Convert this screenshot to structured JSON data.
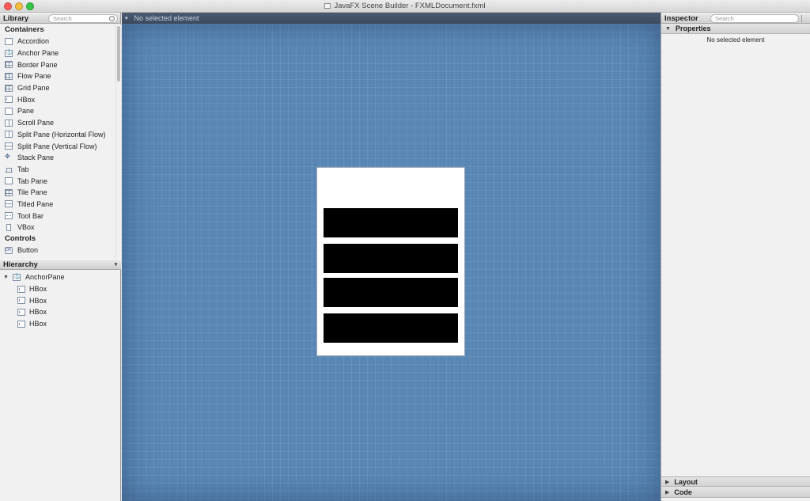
{
  "window": {
    "title": "JavaFX Scene Builder - FXMLDocument.fxml",
    "colors": {
      "close": "#fc5b57",
      "minimize": "#f7bd3e",
      "maximize": "#32c548"
    }
  },
  "library": {
    "title": "Library",
    "search_placeholder": "Search",
    "sections": [
      {
        "title": "Containers",
        "items": [
          {
            "label": "Accordion",
            "icon": "accordion-icon"
          },
          {
            "label": "Anchor Pane",
            "icon": "anchor-pane-icon"
          },
          {
            "label": "Border Pane",
            "icon": "border-pane-icon"
          },
          {
            "label": "Flow Pane",
            "icon": "flow-pane-icon"
          },
          {
            "label": "Grid Pane",
            "icon": "grid-pane-icon"
          },
          {
            "label": "HBox",
            "icon": "hbox-icon"
          },
          {
            "label": "Pane",
            "icon": "pane-icon"
          },
          {
            "label": "Scroll Pane",
            "icon": "scroll-pane-icon"
          },
          {
            "label": "Split Pane (Horizontal Flow)",
            "icon": "split-pane-horizontal-icon"
          },
          {
            "label": "Split Pane (Vertical Flow)",
            "icon": "split-pane-vertical-icon"
          },
          {
            "label": "Stack Pane",
            "icon": "stack-pane-icon"
          },
          {
            "label": "Tab",
            "icon": "tab-icon"
          },
          {
            "label": "Tab Pane",
            "icon": "tab-pane-icon"
          },
          {
            "label": "Tile Pane",
            "icon": "tile-pane-icon"
          },
          {
            "label": "Titled Pane",
            "icon": "titled-pane-icon"
          },
          {
            "label": "Tool Bar",
            "icon": "tool-bar-icon"
          },
          {
            "label": "VBox",
            "icon": "vbox-icon"
          }
        ]
      },
      {
        "title": "Controls",
        "items": [
          {
            "label": "Button",
            "icon": "button-icon"
          }
        ]
      }
    ]
  },
  "hierarchy": {
    "title": "Hierarchy",
    "root": {
      "label": "AnchorPane",
      "icon": "anchor-pane-icon",
      "expanded": true
    },
    "children": [
      {
        "label": "HBox",
        "icon": "hbox-icon"
      },
      {
        "label": "HBox",
        "icon": "hbox-icon"
      },
      {
        "label": "HBox",
        "icon": "hbox-icon"
      },
      {
        "label": "HBox",
        "icon": "hbox-icon"
      }
    ]
  },
  "canvas": {
    "breadcrumb": "No selected element",
    "background_color": "#5987b5",
    "hbox_color": "#000000",
    "hbox_count": 4
  },
  "inspector": {
    "title": "Inspector",
    "search_placeholder": "Search",
    "sections": [
      {
        "label": "Properties",
        "expanded": true,
        "content": "No selected element"
      },
      {
        "label": "Layout",
        "expanded": false
      },
      {
        "label": "Code",
        "expanded": false
      }
    ]
  }
}
